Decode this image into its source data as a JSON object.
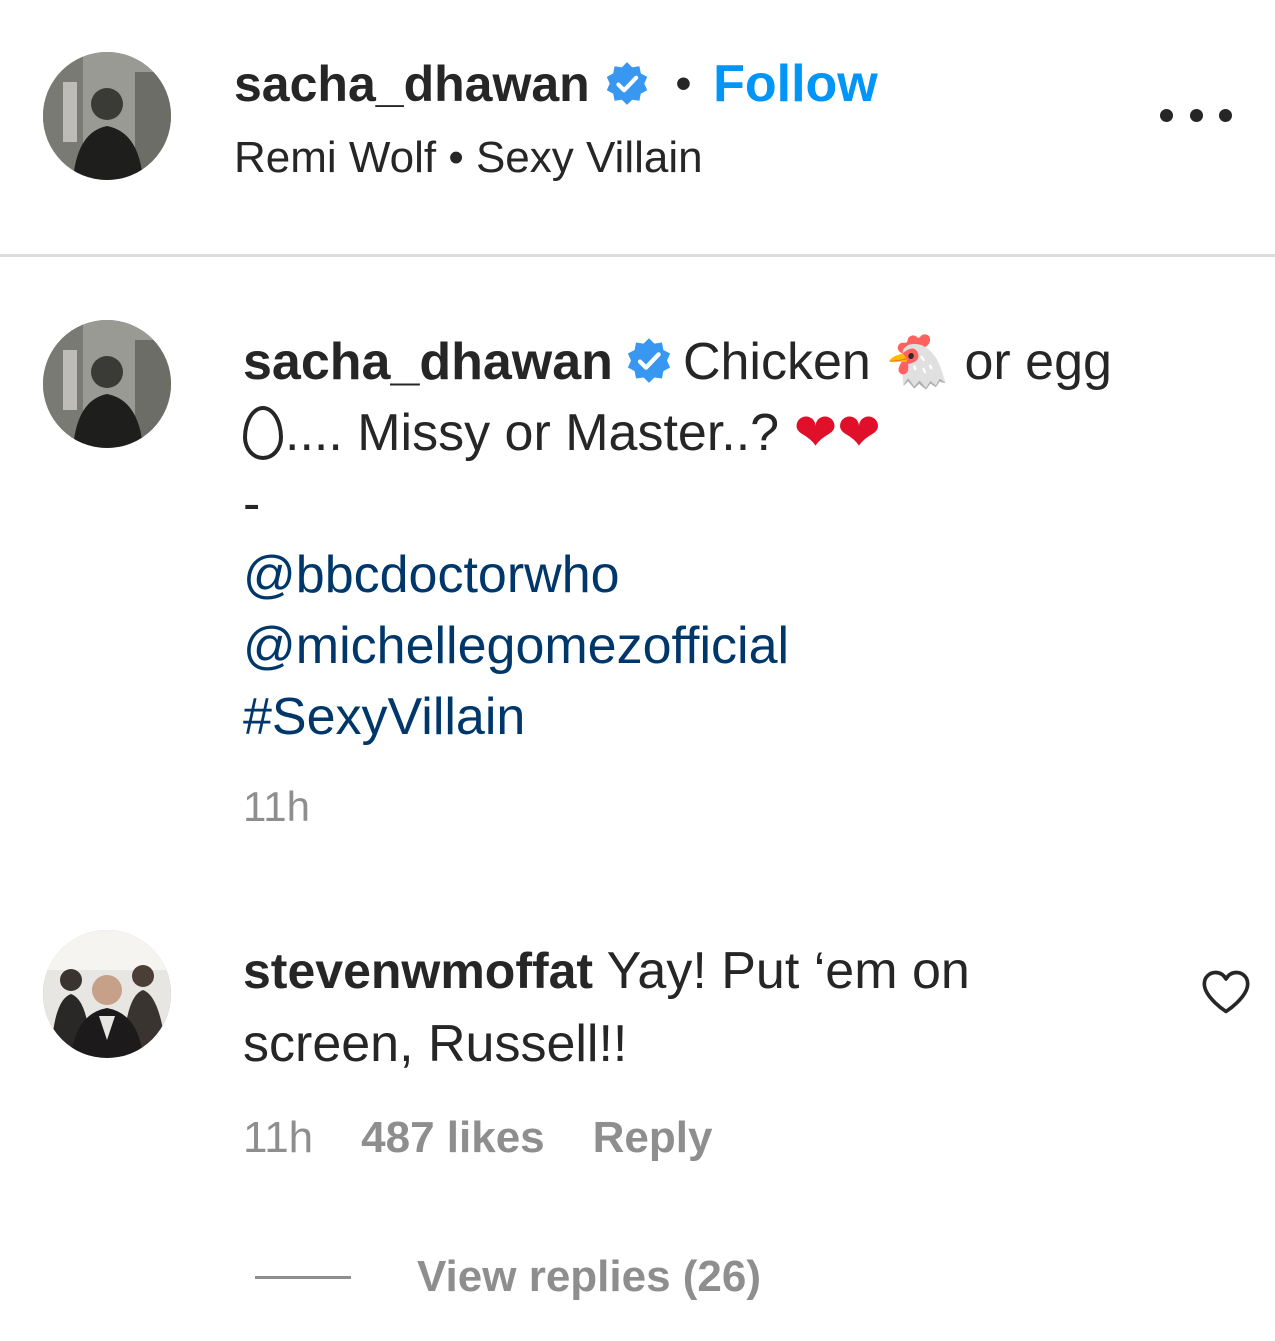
{
  "header": {
    "username": "sacha_dhawan",
    "separator": "•",
    "follow_label": "Follow",
    "audio_line": "Remi Wolf • Sexy Villain",
    "more_icon": "more-horizontal-icon"
  },
  "caption": {
    "username": "sacha_dhawan",
    "text_part1": "Chicken ",
    "chicken_emoji": "🐔",
    "text_part2": " or egg ",
    "text_part3": ".... Missy or Master..? ",
    "hearts": "❤❤",
    "dash": "-",
    "mention1": "@bbcdoctorwho",
    "mention2": "@michellegomezofficial",
    "hashtag": "#SexyVillain",
    "time": "11h"
  },
  "comment": {
    "username": "stevenwmoffat",
    "text": "Yay! Put ‘em on screen, Russell!!",
    "time": "11h",
    "likes": "487 likes",
    "reply_label": "Reply",
    "view_replies": "View replies (26)"
  },
  "colors": {
    "accent": "#0095f6",
    "verified": "#3897f0",
    "link": "#00376b",
    "muted": "#8e8e8e",
    "text": "#262626",
    "divider": "#dbdbdb"
  }
}
